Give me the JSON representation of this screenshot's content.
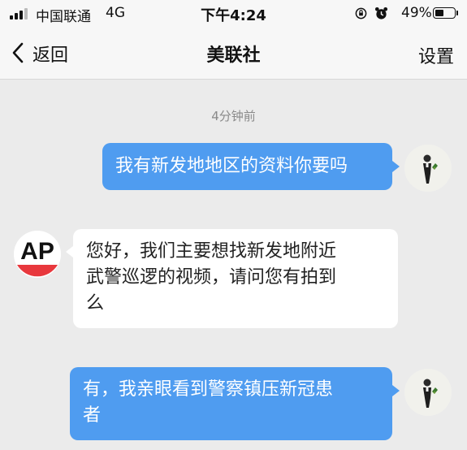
{
  "statusbar": {
    "carrier": "中国联通",
    "network": "4G",
    "time": "下午4:24",
    "battery_percent": "49%",
    "battery_level": 0.49,
    "icons": [
      "signal-icon",
      "rotation-lock-icon",
      "alarm-icon",
      "battery-icon"
    ]
  },
  "nav": {
    "back_label": "返回",
    "title": "美联社",
    "settings_label": "设置"
  },
  "chat": {
    "timestamp": "4分钟前",
    "messages": [
      {
        "from": "me",
        "text": "我有新发地地区的资料你要吗"
      },
      {
        "from": "other",
        "lines": [
          "您好，我们主要想找新发地附近",
          "武警巡逻的视频，请问您有拍到",
          "么"
        ]
      },
      {
        "from": "me",
        "lines": [
          "有，我亲眼看到警察镇压新冠患",
          "者"
        ]
      }
    ],
    "other_avatar_logo": "AP"
  },
  "colors": {
    "outgoing_bubble": "#4f9cf0",
    "incoming_bubble": "#ffffff",
    "background": "#ebebeb",
    "ap_red": "#e8383d"
  }
}
